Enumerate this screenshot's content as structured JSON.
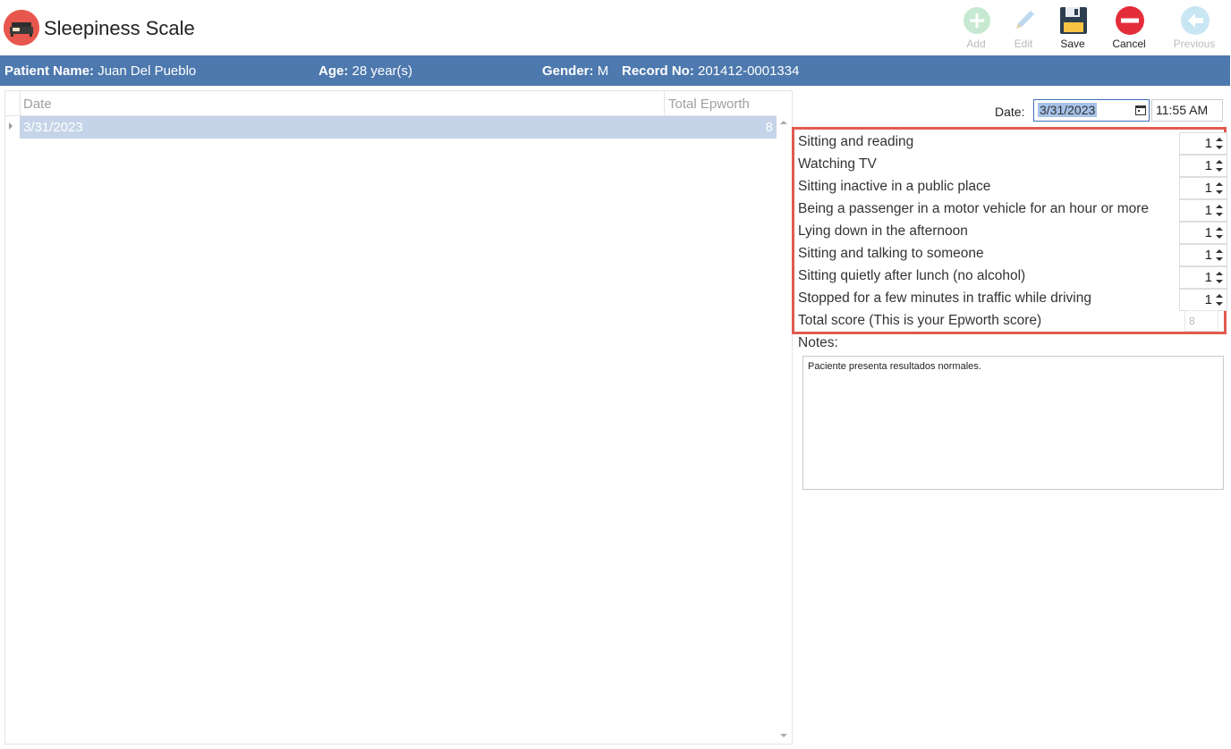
{
  "app": {
    "title": "Sleepiness Scale",
    "icon": "bed-icon"
  },
  "toolbar": {
    "add_label": "Add",
    "edit_label": "Edit",
    "save_label": "Save",
    "cancel_label": "Cancel",
    "previous_label": "Previous"
  },
  "patient": {
    "name_label": "Patient Name:",
    "name": "Juan Del Pueblo",
    "age_label": "Age:",
    "age": "28 year(s)",
    "gender_label": "Gender:",
    "gender": "M",
    "record_label": "Record No:",
    "record": "201412-0001334"
  },
  "grid": {
    "columns": [
      "Date",
      "Total Epworth"
    ],
    "rows": [
      {
        "date": "3/31/2023",
        "total": "8"
      }
    ]
  },
  "form": {
    "date_label": "Date:",
    "date_value": "3/31/2023",
    "time_value": "11:55 AM",
    "questions": [
      {
        "label": "Sitting and reading",
        "value": "1"
      },
      {
        "label": "Watching TV",
        "value": "1"
      },
      {
        "label": "Sitting inactive in a public place",
        "value": "1"
      },
      {
        "label": "Being a passenger in a motor vehicle for an hour or more",
        "value": "1"
      },
      {
        "label": "Lying down in the afternoon",
        "value": "1"
      },
      {
        "label": "Sitting and talking to someone",
        "value": "1"
      },
      {
        "label": "Sitting quietly after lunch (no alcohol)",
        "value": "1"
      },
      {
        "label": "Stopped for a few minutes in traffic while driving",
        "value": "1"
      }
    ],
    "total_label": "Total score (This is your Epworth score)",
    "total_value": "8",
    "notes_label": "Notes:",
    "notes_text": "Paciente presenta resultados normales."
  },
  "colors": {
    "accent": "#4e79ae",
    "highlight_border": "#e05b50",
    "selected_row": "#c5d4e8"
  }
}
